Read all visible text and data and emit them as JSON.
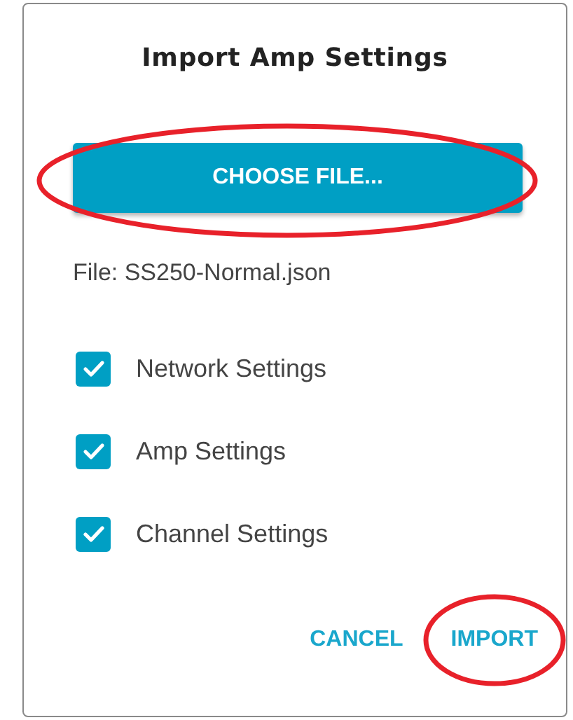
{
  "dialog": {
    "title": "Import Amp Settings",
    "choose_button": {
      "label": "CHOOSE FILE...",
      "circled": true
    },
    "file_label": "File: SS250-Normal.json",
    "options": [
      {
        "label": "Network Settings",
        "checked": true
      },
      {
        "label": "Amp Settings",
        "checked": true
      },
      {
        "label": "Channel Settings",
        "checked": true
      }
    ],
    "actions": [
      {
        "label": "CANCEL",
        "circled": false
      },
      {
        "label": "IMPORT",
        "circled": true
      }
    ]
  }
}
